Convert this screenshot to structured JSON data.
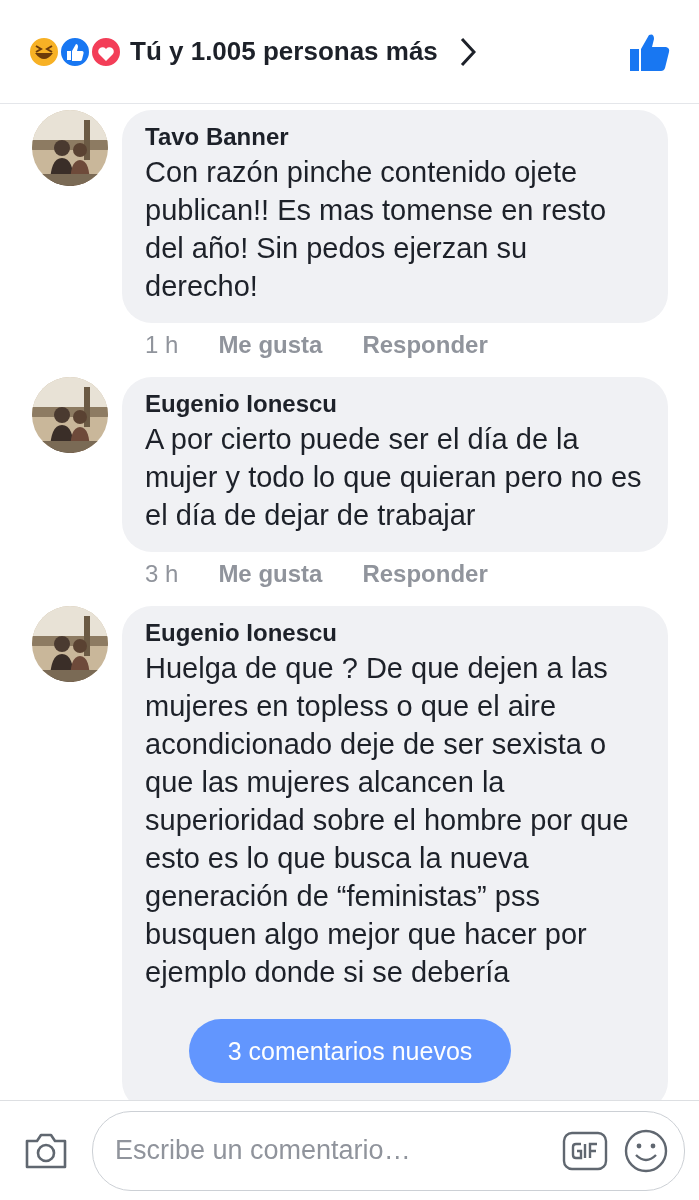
{
  "header": {
    "reactions_text": "Tú y 1.005 personas más"
  },
  "comments": [
    {
      "author": "Tavo Banner",
      "text": "Con razón pinche contenido ojete publican!! Es mas tomense en resto del año! Sin pedos ejerzan su derecho!",
      "time": "1 h",
      "actions": [
        "Me gusta",
        "Responder"
      ],
      "avatar": {
        "kind": "picture"
      }
    },
    {
      "author": "Eugenio Ionescu",
      "text": "A por cierto puede ser el día de la mujer y todo lo que quieran pero no es el día de dejar de trabajar",
      "time": "3 h",
      "actions": [
        "Me gusta",
        "Responder"
      ],
      "avatar": {
        "kind": "picture"
      }
    },
    {
      "author": "Eugenio Ionescu",
      "text": "Huelga de que ? De que dejen a las mujeres en topless o que el aire acondicionado deje de ser sexista o que las mujeres alcancen la superioridad sobre el hombre por que esto es lo que busca la nueva generación de “feministas” pss busquen algo mejor que hacer por ejemplo donde si se debería",
      "avatar": {
        "kind": "picture"
      }
    }
  ],
  "new_comments_pill": "3 comentarios nuevos",
  "composer": {
    "placeholder": "Escribe un comentario…"
  }
}
